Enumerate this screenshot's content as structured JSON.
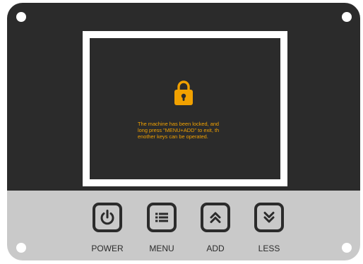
{
  "screen": {
    "lock_icon": "padlock-icon",
    "message_lines": [
      "The machine has been locked, and",
      "long press \"MENU+ADD\" to exit, th",
      "enother keys can be operated."
    ]
  },
  "buttons": [
    {
      "label": "POWER",
      "icon": "power-icon"
    },
    {
      "label": "MENU",
      "icon": "menu-icon"
    },
    {
      "label": "ADD",
      "icon": "chevron-up-icon"
    },
    {
      "label": "LESS",
      "icon": "chevron-down-icon"
    }
  ],
  "colors": {
    "panel": "#2b2b2b",
    "button_strip": "#c9c9c9",
    "accent": "#f1a100",
    "frame": "#ffffff"
  }
}
